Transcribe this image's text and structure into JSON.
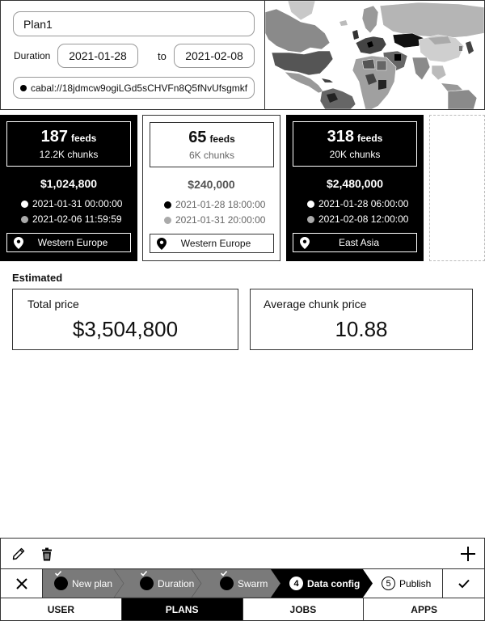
{
  "plan": {
    "name": "Plan1",
    "duration_label": "Duration",
    "date_from": "2021-01-28",
    "to_label": "to",
    "date_to": "2021-02-08",
    "address": "cabal://18jdmcw9ogiLGd5sCHVFn8Q5fNvUfsgmkf"
  },
  "cards": [
    {
      "style": "dark",
      "feeds": "187",
      "feeds_label": "feeds",
      "chunks": "12.2K chunks",
      "price": "$1,024,800",
      "start": "2021-01-31 00:00:00",
      "end": "2021-02-06 11:59:59",
      "region": "Western Europe"
    },
    {
      "style": "light",
      "feeds": "65",
      "feeds_label": "feeds",
      "chunks": "6K chunks",
      "price": "$240,000",
      "start": "2021-01-28 18:00:00",
      "end": "2021-01-31 20:00:00",
      "region": "Western Europe"
    },
    {
      "style": "dark",
      "feeds": "318",
      "feeds_label": "feeds",
      "chunks": "20K chunks",
      "price": "$2,480,000",
      "start": "2021-01-28 06:00:00",
      "end": "2021-02-08 12:00:00",
      "region": "East Asia"
    }
  ],
  "estimated": {
    "title": "Estimated",
    "total_label": "Total price",
    "total_value": "$3,504,800",
    "avg_label": "Average chunk price",
    "avg_value": "10.88"
  },
  "steps": [
    {
      "label": "New plan",
      "state": "done"
    },
    {
      "label": "Duration",
      "state": "done"
    },
    {
      "label": "Swarm",
      "state": "done"
    },
    {
      "label": "Data config",
      "state": "current",
      "number": "4"
    },
    {
      "label": "Publish",
      "state": "todo",
      "number": "5"
    }
  ],
  "nav": {
    "user": "USER",
    "plans": "PLANS",
    "jobs": "JOBS",
    "apps": "APPS",
    "active": "plans"
  },
  "icons": [
    "pencil-icon",
    "trash-icon",
    "plus-icon",
    "close-icon",
    "check-icon",
    "map-pin-icon",
    "world-map"
  ]
}
